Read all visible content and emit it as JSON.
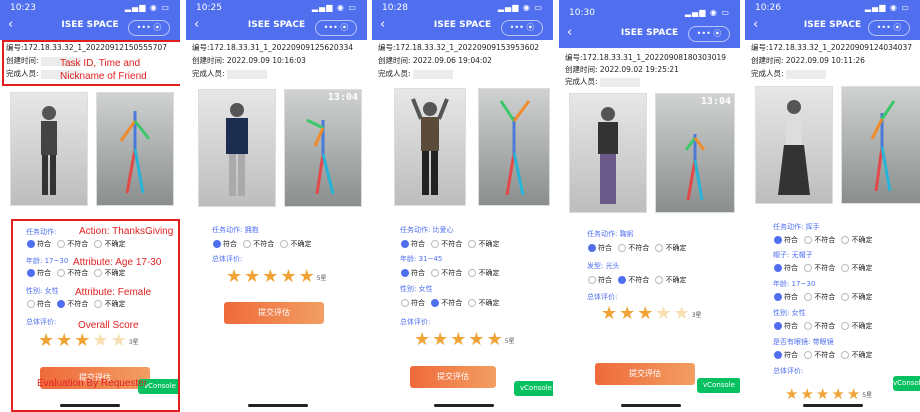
{
  "app_title": "ISEE SPACE",
  "capsule_icons": "••• ⦿",
  "labels": {
    "task_id": "编号:",
    "created": "创建时间:",
    "finisher": "完成人员:",
    "action": "任务动作:",
    "age": "年龄:",
    "gender": "性别:",
    "overall": "总体评价:",
    "hat": "帽子:",
    "hairstyle": "发型:",
    "glasses": "是否有眼镜:"
  },
  "radio_options": [
    "符合",
    "不符合",
    "不确定"
  ],
  "submit_label": "提交评估",
  "vconsole_label": "vConsole",
  "phones": [
    {
      "time": "10:23",
      "task_id": "172.18.33.32_1_20220912150555707",
      "created_label": "创建时间:",
      "created": "",
      "action": "",
      "age": "17~30",
      "gender": "女性",
      "star_label": "3星",
      "stars": 3
    },
    {
      "time": "10:25",
      "task_id": "172.18.33.31_1_20220909125620334",
      "created": "2022.09.09 10:16:03",
      "action": "拥抱",
      "star_label": "5星",
      "stars": 5
    },
    {
      "time": "10:28",
      "task_id": "172.18.33.32_1_20220909153953602",
      "created": "2022.09.06 19:04:02",
      "action": "比爱心",
      "age": "31~45",
      "gender": "女性",
      "star_label": "5星",
      "stars": 5
    },
    {
      "time": "10:30",
      "task_id": "172.18.33.31_1_20220908180303019",
      "created": "2022.09.02 19:25:21",
      "action": "鞠躬",
      "hairstyle": "光头",
      "star_label": "3星",
      "stars": 3
    },
    {
      "time": "10:26",
      "task_id": "172.18.33.32_1_20220909124034037",
      "created": "2022.09.09 10:11:26",
      "action": "挥手",
      "hat": "无帽子",
      "age": "17~30",
      "gender": "女性",
      "glasses": "带眼镜",
      "star_label": "5星",
      "stars": 5
    }
  ],
  "pose_timestamp": "13:04",
  "annotations": {
    "task_info": "Task ID, Time and\nNickname of Friend",
    "action": "Action: ThanksGiving",
    "age": "Attribute: Age 17-30",
    "gender": "Attribute: Female",
    "score": "Overall Score",
    "evaluation": "Evaluation By Requester"
  },
  "colors": {
    "header": "#4F6FEF",
    "accent": "#4F6FEF",
    "star": "#f0a437",
    "submit": "#ef6a3b",
    "vconsole": "#07c160",
    "annotation": "#e02020"
  }
}
